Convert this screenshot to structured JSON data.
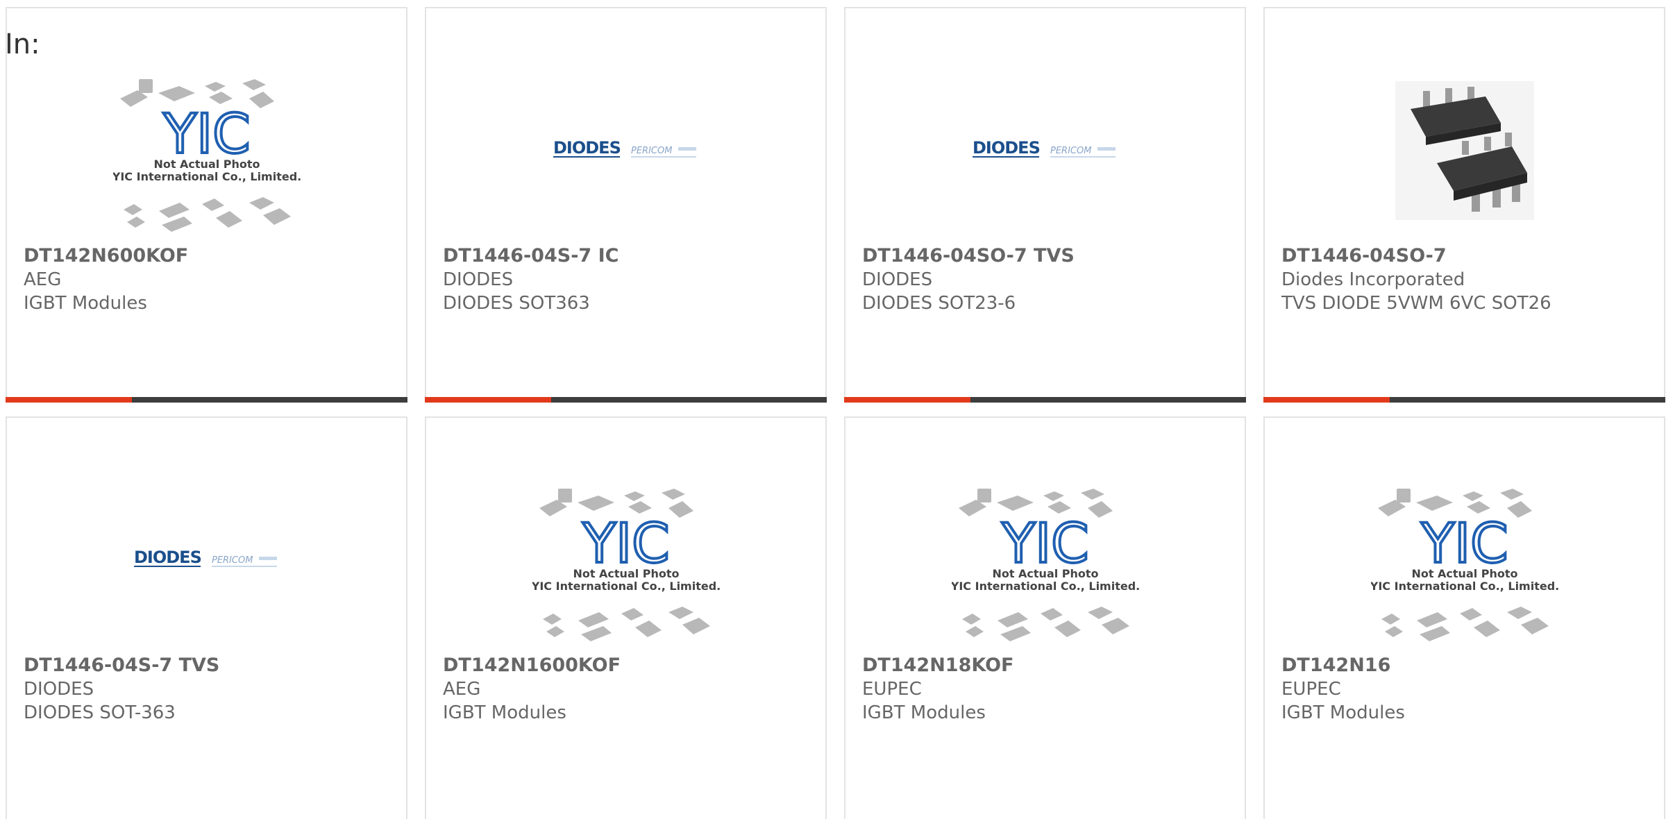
{
  "page": {
    "heading": "In:"
  },
  "colors": {
    "accent": "#e13a1b",
    "bar": "#3d3d3d",
    "border": "#e3e3e3",
    "text": "#666666"
  },
  "products": [
    {
      "part_number": "DT142N600KOF",
      "manufacturer": "AEG",
      "description": "IGBT Modules",
      "image": "not-actual-photo",
      "not_actual_photo_text": "Not Actual Photo",
      "company_text": "YIC International Co., Limited.",
      "logo_text": "YIC"
    },
    {
      "part_number": "DT1446-04S-7 IC",
      "manufacturer": "DIODES",
      "description": "DIODES SOT363",
      "image": "diodes-logo",
      "logo_text": "DIODES",
      "logo_sub": "PERICOM"
    },
    {
      "part_number": "DT1446-04SO-7 TVS",
      "manufacturer": "DIODES",
      "description": "DIODES SOT23-6",
      "image": "diodes-logo",
      "logo_text": "DIODES",
      "logo_sub": "PERICOM"
    },
    {
      "part_number": "DT1446-04SO-7",
      "manufacturer": "Diodes Incorporated",
      "description": "TVS DIODE 5VWM 6VC SOT26",
      "image": "sot26-package"
    },
    {
      "part_number": "DT1446-04S-7 TVS",
      "manufacturer": "DIODES",
      "description": "DIODES SOT-363",
      "image": "diodes-logo",
      "logo_text": "DIODES",
      "logo_sub": "PERICOM"
    },
    {
      "part_number": "DT142N1600KOF",
      "manufacturer": "AEG",
      "description": "IGBT Modules",
      "image": "not-actual-photo",
      "not_actual_photo_text": "Not Actual Photo",
      "company_text": "YIC International Co., Limited.",
      "logo_text": "YIC"
    },
    {
      "part_number": "DT142N18KOF",
      "manufacturer": "EUPEC",
      "description": "IGBT Modules",
      "image": "not-actual-photo",
      "not_actual_photo_text": "Not Actual Photo",
      "company_text": "YIC International Co., Limited.",
      "logo_text": "YIC"
    },
    {
      "part_number": "DT142N16",
      "manufacturer": "EUPEC",
      "description": "IGBT Modules",
      "image": "not-actual-photo",
      "not_actual_photo_text": "Not Actual Photo",
      "company_text": "YIC International Co., Limited.",
      "logo_text": "YIC"
    }
  ]
}
